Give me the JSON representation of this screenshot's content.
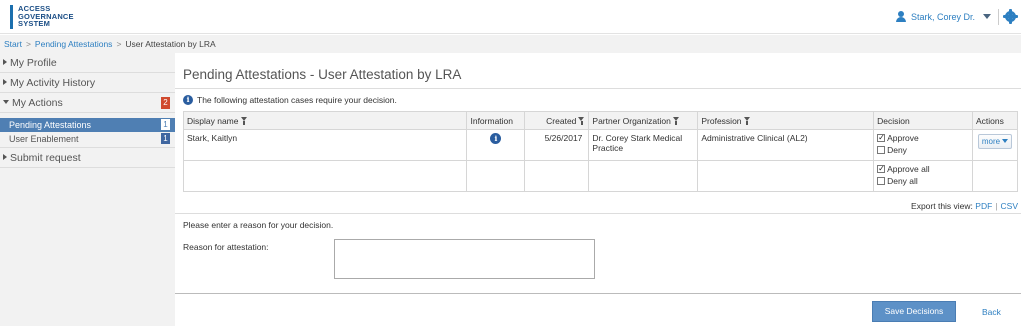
{
  "header": {
    "logo_lines": [
      "ACCESS",
      "GOVERNANCE",
      "SYSTEM"
    ],
    "user_name": "Stark, Corey Dr."
  },
  "breadcrumb": {
    "items": [
      "Start",
      "Pending Attestations"
    ],
    "current": "User Attestation by LRA"
  },
  "sidebar": {
    "items": [
      {
        "label": "My Profile"
      },
      {
        "label": "My Activity History"
      },
      {
        "label": "My Actions",
        "badge": "2"
      },
      {
        "label": "Submit request"
      }
    ],
    "sub_items": [
      {
        "label": "Pending Attestations",
        "badge": "1"
      },
      {
        "label": "User Enablement",
        "badge": "1"
      }
    ]
  },
  "main": {
    "title": "Pending Attestations - User Attestation by LRA",
    "info_text": "The following attestation cases require your decision.",
    "table": {
      "headers": {
        "display_name": "Display name",
        "information": "Information",
        "created": "Created",
        "partner_org": "Partner Organization",
        "profession": "Profession",
        "decision": "Decision",
        "actions": "Actions"
      },
      "rows": [
        {
          "display_name": "Stark, Kaitlyn",
          "created": "5/26/2017",
          "partner_org": "Dr. Corey Stark Medical Practice",
          "profession": "Administrative Clinical (AL2)",
          "approve_label": "Approve",
          "deny_label": "Deny",
          "approve_checked": true,
          "deny_checked": false,
          "action_label": "more"
        }
      ],
      "footer": {
        "approve_all_label": "Approve all",
        "deny_all_label": "Deny all",
        "approve_all_checked": true,
        "deny_all_checked": false
      }
    },
    "export": {
      "label": "Export this view:",
      "pdf": "PDF",
      "csv": "CSV"
    },
    "reason_hint": "Please enter a reason for your decision.",
    "reason_label": "Reason for attestation:",
    "reason_value": "",
    "save_label": "Save Decisions",
    "back_label": "Back"
  },
  "colors": {
    "accent": "#2d7fc1",
    "active_nav": "#4f7fb3",
    "badge_red": "#d04a2e",
    "save_button": "#5d91c7"
  }
}
